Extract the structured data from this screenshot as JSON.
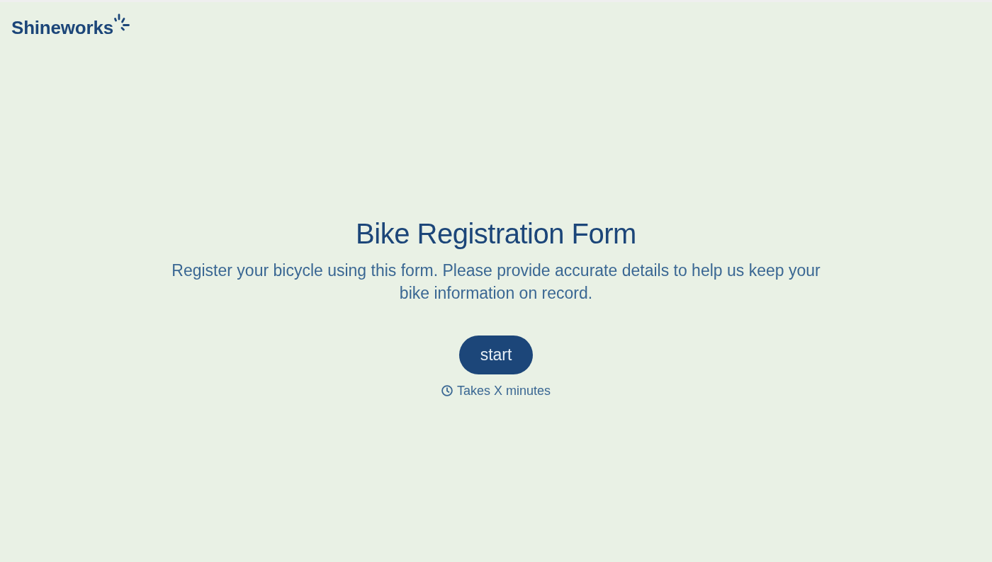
{
  "header": {
    "logo": {
      "text": "Shineworks"
    }
  },
  "intro": {
    "title": "Bike Registration Form",
    "description": "Register your bicycle using this form. Please provide accurate details to help us keep your bike information on record.",
    "start_button": "start",
    "duration": "Takes X minutes"
  }
}
